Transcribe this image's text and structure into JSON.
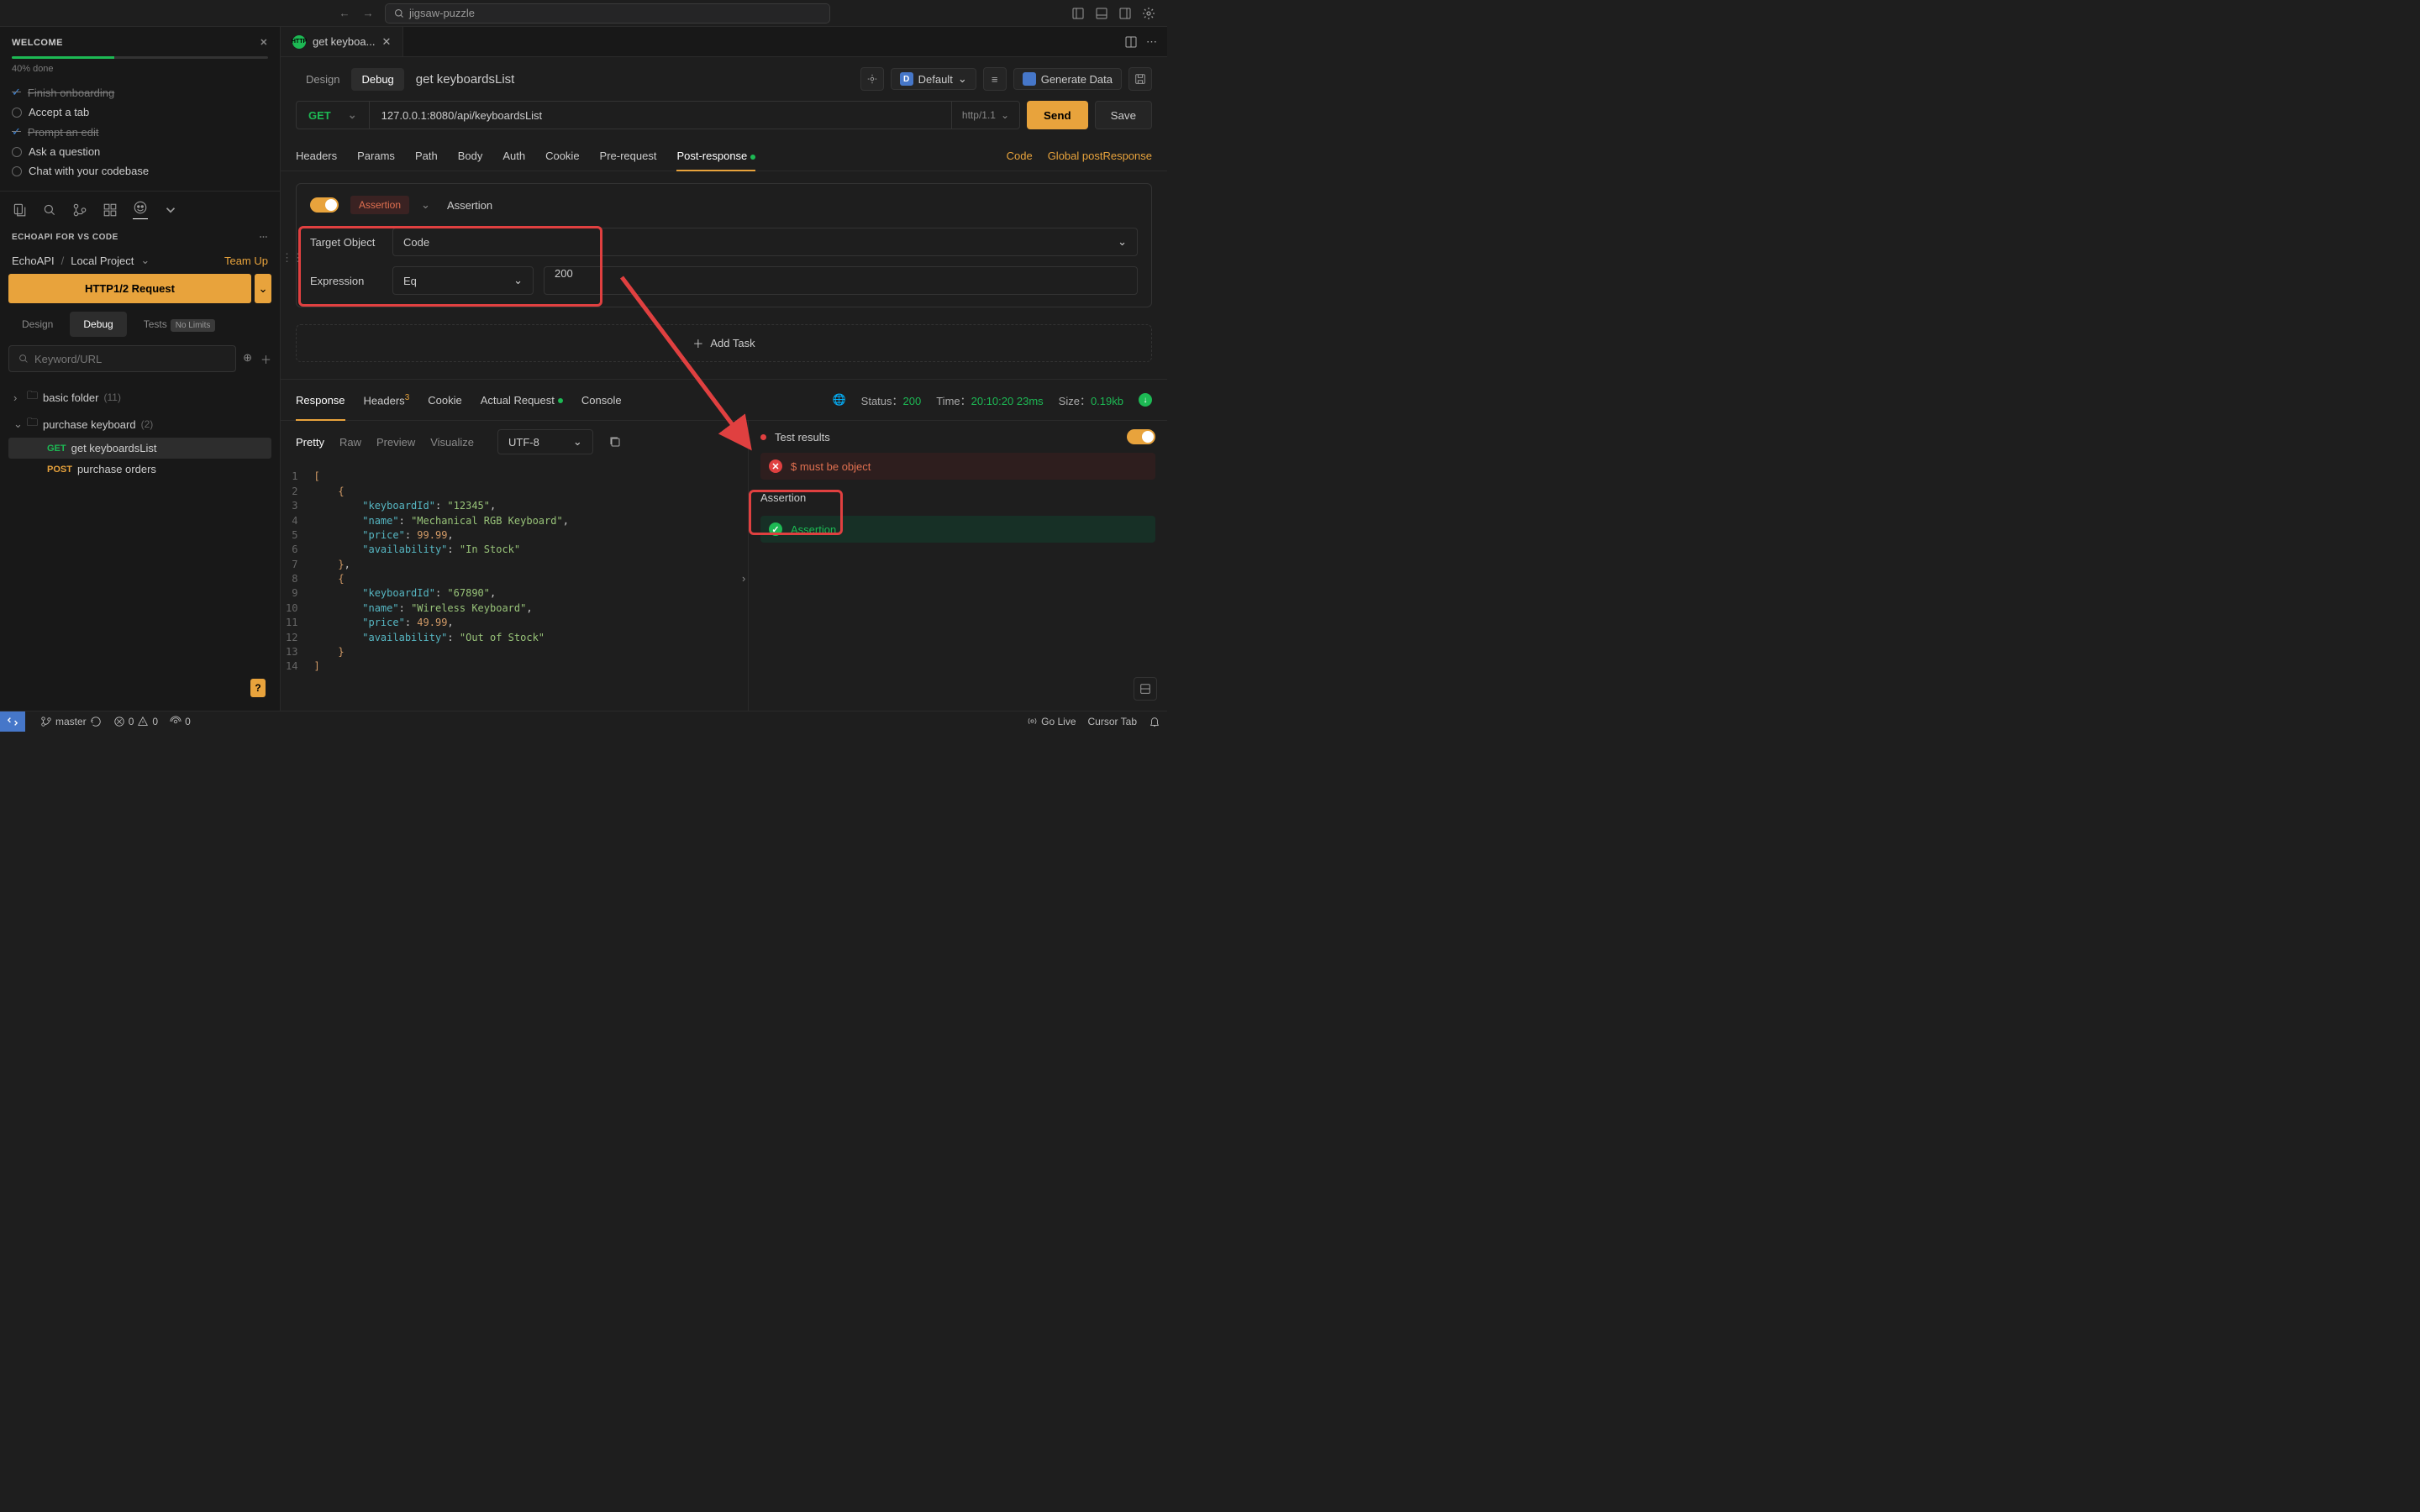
{
  "titlebar": {
    "search": "jigsaw-puzzle"
  },
  "welcome": {
    "title": "WELCOME",
    "progress_pct": 40,
    "progress_text": "40% done",
    "items": [
      {
        "label": "Finish onboarding",
        "done": true
      },
      {
        "label": "Accept a tab",
        "done": false
      },
      {
        "label": "Prompt an edit",
        "done": true
      },
      {
        "label": "Ask a question",
        "done": false
      },
      {
        "label": "Chat with your codebase",
        "done": false
      }
    ]
  },
  "extension": {
    "header": "ECHOAPI FOR VS CODE",
    "breadcrumb": {
      "root": "EchoAPI",
      "project": "Local Project"
    },
    "team_up": "Team Up",
    "http_button": "HTTP1/2 Request",
    "tabs": {
      "design": "Design",
      "debug": "Debug",
      "tests": "Tests",
      "nolimits": "No Limits"
    },
    "search_placeholder": "Keyword/URL"
  },
  "tree": {
    "folders": [
      {
        "name": "basic folder",
        "count": "(11)",
        "expanded": false
      },
      {
        "name": "purchase keyboard",
        "count": "(2)",
        "expanded": true,
        "children": [
          {
            "method": "GET",
            "name": "get keyboardsList",
            "selected": true
          },
          {
            "method": "POST",
            "name": "purchase orders",
            "selected": false
          }
        ]
      }
    ]
  },
  "editor": {
    "tab_title": "get keyboa...",
    "mode_tabs": {
      "design": "Design",
      "debug": "Debug"
    },
    "title": "get keyboardsList",
    "env_default": "Default",
    "generate_data": "Generate Data",
    "method": "GET",
    "url": "127.0.0.1:8080/api/keyboardsList",
    "protocol": "http/1.1",
    "send": "Send",
    "save": "Save"
  },
  "req_tabs": {
    "items": [
      "Headers",
      "Params",
      "Path",
      "Body",
      "Auth",
      "Cookie",
      "Pre-request",
      "Post-response"
    ],
    "active": "Post-response",
    "code": "Code",
    "global": "Global postResponse"
  },
  "assertion": {
    "badge": "Assertion",
    "label": "Assertion",
    "target_object_label": "Target Object",
    "target_object_value": "Code",
    "expression_label": "Expression",
    "expression_op": "Eq",
    "expression_value": "200",
    "add_task": "Add Task"
  },
  "response": {
    "tabs": {
      "response": "Response",
      "headers": "Headers",
      "headers_count": "3",
      "cookie": "Cookie",
      "actual": "Actual Request",
      "console": "Console"
    },
    "status_label": "Status：",
    "status_value": "200",
    "time_label": "Time：",
    "time_value": "20:10:20",
    "time_ms": "23ms",
    "size_label": "Size：",
    "size_value": "0.19kb",
    "view_tabs": {
      "pretty": "Pretty",
      "raw": "Raw",
      "preview": "Preview",
      "visualize": "Visualize"
    },
    "encoding": "UTF-8",
    "body": [
      {
        "keyboardId": "12345",
        "name": "Mechanical RGB Keyboard",
        "price": 99.99,
        "availability": "In Stock"
      },
      {
        "keyboardId": "67890",
        "name": "Wireless Keyboard",
        "price": 49.99,
        "availability": "Out of Stock"
      }
    ],
    "test_results_label": "Test results",
    "results": [
      {
        "ok": false,
        "text": "$ must be object"
      }
    ],
    "assertion_section": "Assertion",
    "assertion_results": [
      {
        "ok": true,
        "text": "Assertion"
      }
    ]
  },
  "statusbar": {
    "branch": "master",
    "errors": "0",
    "warnings": "0",
    "ports": "0",
    "golive": "Go Live",
    "cursor_tab": "Cursor Tab"
  }
}
